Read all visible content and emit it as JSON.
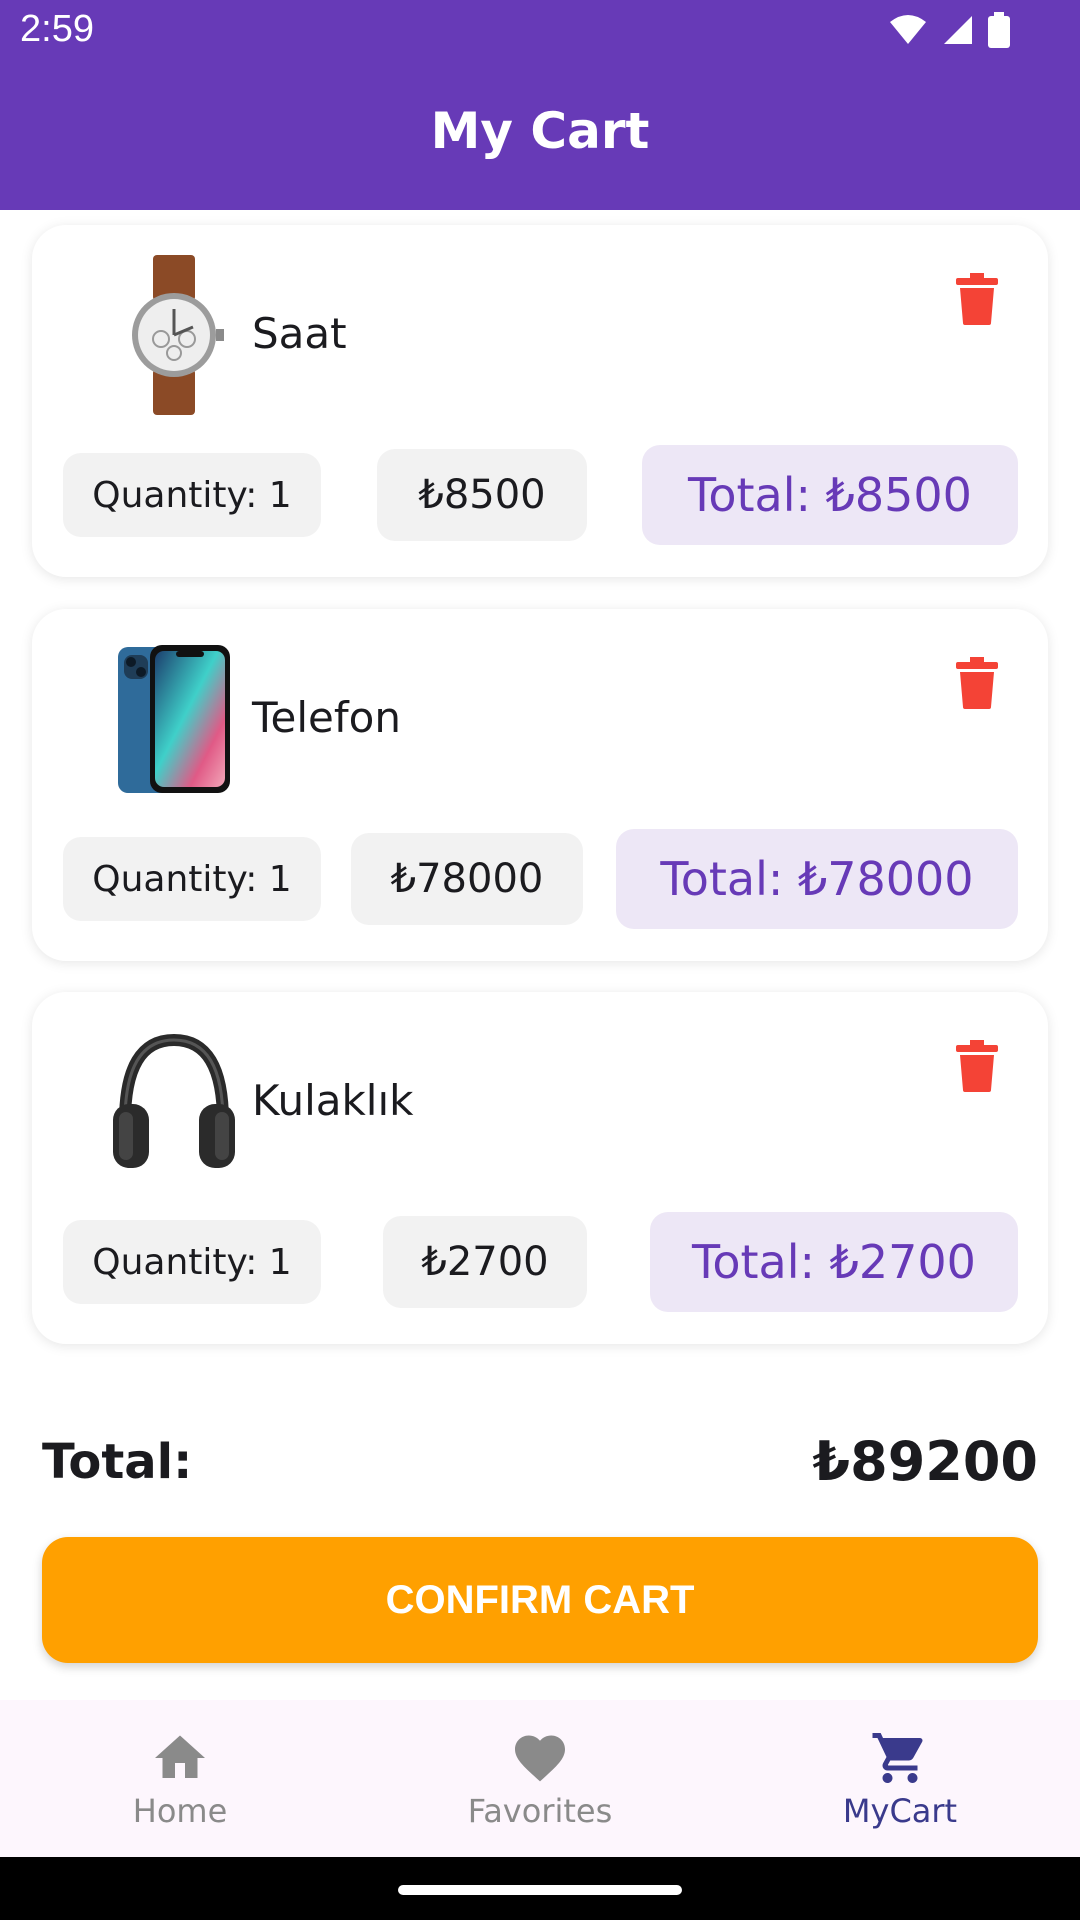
{
  "status": {
    "time": "2:59"
  },
  "header": {
    "title": "My Cart"
  },
  "items": [
    {
      "name": "Saat",
      "quantity": "Quantity: 1",
      "price": "₺8500",
      "total": "Total: ₺8500",
      "image": "watch-image"
    },
    {
      "name": "Telefon",
      "quantity": "Quantity: 1",
      "price": "₺78000",
      "total": "Total: ₺78000",
      "image": "phone-image"
    },
    {
      "name": "Kulaklık",
      "quantity": "Quantity: 1",
      "price": "₺2700",
      "total": "Total: ₺2700",
      "image": "headphones-image"
    }
  ],
  "summary": {
    "label": "Total:",
    "value": "₺89200"
  },
  "confirm": {
    "label": "CONFIRM CART"
  },
  "nav": {
    "home": "Home",
    "favorites": "Favorites",
    "mycart": "MyCart"
  },
  "colors": {
    "primary": "#673ab7",
    "accent": "#ffa000",
    "delete": "#f44336",
    "nav_active": "#3a3a8c"
  }
}
